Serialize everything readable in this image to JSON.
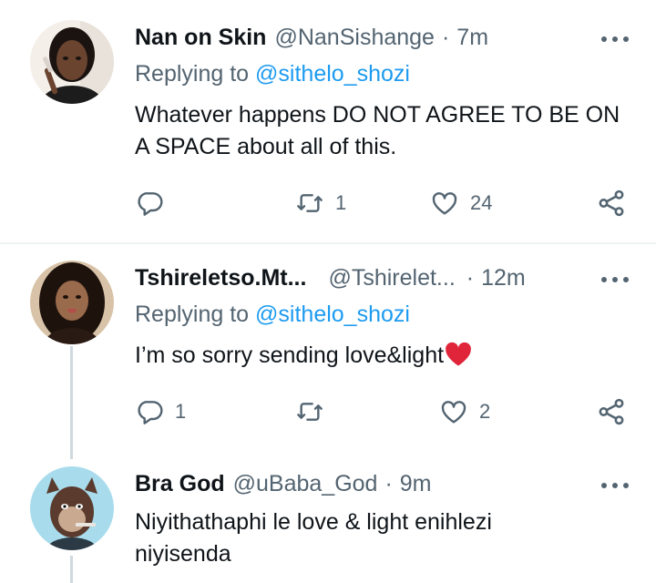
{
  "tweets": [
    {
      "name": "Nan on Skin",
      "handle": "@NanSishange",
      "separator": "·",
      "time": "7m",
      "reply_prefix": "Replying to",
      "reply_to": "@sithelo_shozi",
      "text": "Whatever happens DO NOT AGREE TO BE ON A SPACE about all of this.",
      "reply_count": "",
      "retweet_count": "1",
      "like_count": "24"
    },
    {
      "name": "Tshireletso.Mt...",
      "handle": "@Tshirelet...",
      "separator": "·",
      "time": "12m",
      "reply_prefix": "Replying to",
      "reply_to": "@sithelo_shozi",
      "text": "I’m so sorry sending love&light",
      "emoji": "heart-emoji",
      "reply_count": "1",
      "retweet_count": "",
      "like_count": "2"
    },
    {
      "name": "Bra God",
      "handle": "@uBaba_God",
      "separator": "·",
      "time": "9m",
      "text": "Niyithathaphi le love & light enihlezi niyisenda"
    }
  ],
  "icons": {
    "reply": "reply-icon",
    "retweet": "retweet-icon",
    "like": "heart-icon",
    "share": "share-icon",
    "more": "more-icon"
  },
  "colors": {
    "link": "#1d9bf0",
    "secondary": "#536471",
    "primary_text": "#0f1419",
    "divider": "#eff3f4",
    "emoji_heart": "#e0243a"
  }
}
